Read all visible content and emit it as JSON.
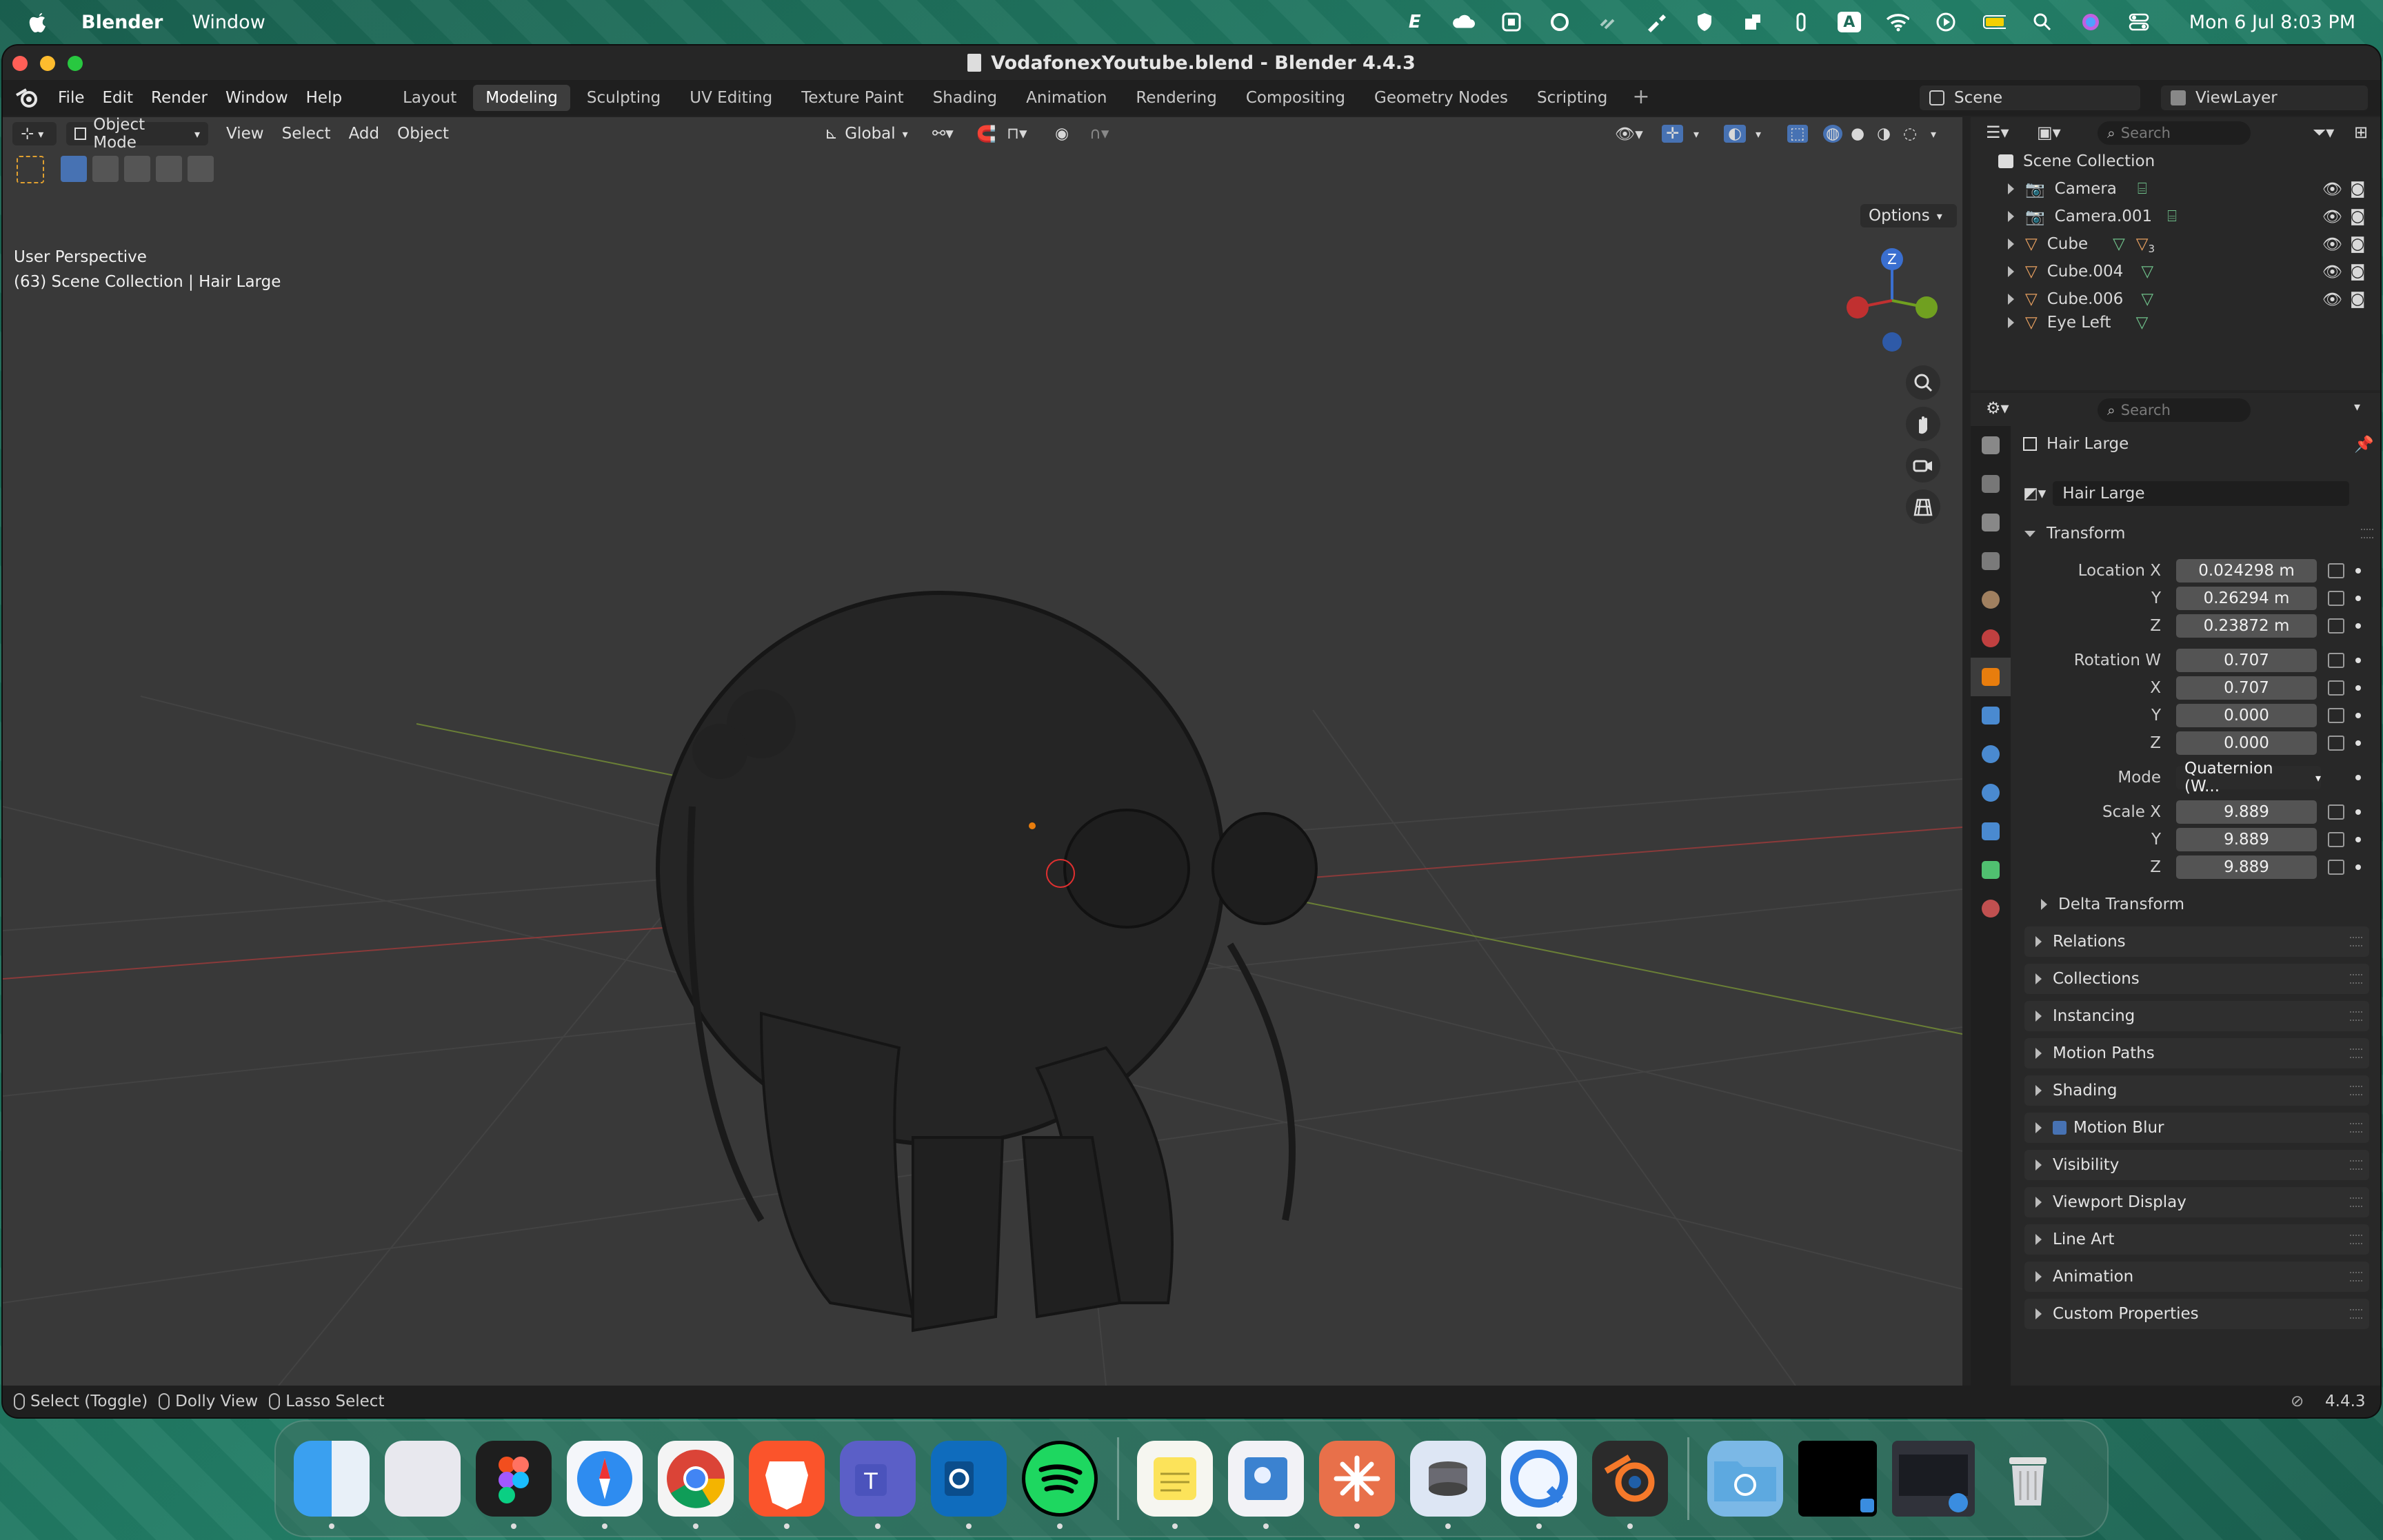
{
  "menubar": {
    "app_name": "Blender",
    "items": [
      "Window"
    ],
    "clock": "Mon 6 Jul  8:03 PM",
    "status_icons": [
      "text-e-icon",
      "cloud-icon",
      "grid-icon",
      "ring-icon",
      "link-icon",
      "brush-icon",
      "shield-icon",
      "puzzle-icon",
      "paperclip-icon",
      "keyboard-a-icon",
      "wifi-icon",
      "play-icon",
      "battery-icon",
      "search-icon",
      "siri-icon",
      "control-center-icon"
    ],
    "keyboard_letter": "A"
  },
  "window": {
    "title": "VodafonexYoutube.blend - Blender 4.4.3"
  },
  "topbar": {
    "menus": [
      "File",
      "Edit",
      "Render",
      "Window",
      "Help"
    ],
    "tabs": [
      {
        "label": "Layout",
        "active": false
      },
      {
        "label": "Modeling",
        "active": true
      },
      {
        "label": "Sculpting",
        "active": false
      },
      {
        "label": "UV Editing",
        "active": false
      },
      {
        "label": "Texture Paint",
        "active": false
      },
      {
        "label": "Shading",
        "active": false
      },
      {
        "label": "Animation",
        "active": false
      },
      {
        "label": "Rendering",
        "active": false
      },
      {
        "label": "Compositing",
        "active": false
      },
      {
        "label": "Geometry Nodes",
        "active": false
      },
      {
        "label": "Scripting",
        "active": false
      }
    ],
    "add_tab": "+",
    "scene": "Scene",
    "view_layer": "ViewLayer"
  },
  "viewport": {
    "mode": "Object Mode",
    "menus": [
      "View",
      "Select",
      "Add",
      "Object"
    ],
    "orientation": "Global",
    "options": "Options",
    "info_line1": "User Perspective",
    "info_line2": "(63) Scene Collection | Hair Large",
    "gizmo_axis_label": "Z"
  },
  "outliner": {
    "search_placeholder": "Search",
    "root": "Scene Collection",
    "items": [
      {
        "name": "Camera",
        "type": "camera"
      },
      {
        "name": "Camera.001",
        "type": "camera"
      },
      {
        "name": "Cube",
        "type": "mesh",
        "badge": "3"
      },
      {
        "name": "Cube.004",
        "type": "mesh"
      },
      {
        "name": "Cube.006",
        "type": "mesh"
      },
      {
        "name": "Eye Left",
        "type": "mesh"
      }
    ]
  },
  "properties": {
    "search_placeholder": "Search",
    "object_name": "Hair Large",
    "datablock_name": "Hair Large",
    "transform_header": "Transform",
    "location": {
      "label_x": "Location X",
      "label_y": "Y",
      "label_z": "Z",
      "x": "0.024298 m",
      "y": "0.26294 m",
      "z": "0.23872 m"
    },
    "rotation": {
      "label_w": "Rotation W",
      "label_x": "X",
      "label_y": "Y",
      "label_z": "Z",
      "w": "0.707",
      "x": "0.707",
      "y": "0.000",
      "z": "0.000"
    },
    "mode_label": "Mode",
    "mode_value": "Quaternion (W...",
    "scale": {
      "label_x": "Scale X",
      "label_y": "Y",
      "label_z": "Z",
      "x": "9.889",
      "y": "9.889",
      "z": "9.889"
    },
    "delta_transform": "Delta Transform",
    "sections": [
      "Relations",
      "Collections",
      "Instancing",
      "Motion Paths",
      "Shading",
      "Motion Blur",
      "Visibility",
      "Viewport Display",
      "Line Art",
      "Animation",
      "Custom Properties"
    ]
  },
  "statusbar": {
    "select": "Select (Toggle)",
    "dolly": "Dolly View",
    "lasso": "Lasso Select",
    "version": "4.4.3"
  },
  "dock": {
    "apps": [
      "finder",
      "launchpad",
      "figma",
      "safari",
      "chrome",
      "brave",
      "teams",
      "outlook",
      "spotify",
      "notes",
      "preview",
      "claude",
      "disk-utility",
      "qbittorrent",
      "blender"
    ],
    "others": [
      "downloads-folder",
      "terminal-window",
      "screenshot-window",
      "trash"
    ]
  },
  "colors": {
    "accent_orange": "#e87d0d",
    "active_tab": "#3d3d3d",
    "field": "#545454",
    "viewport_bg": "#393939"
  }
}
